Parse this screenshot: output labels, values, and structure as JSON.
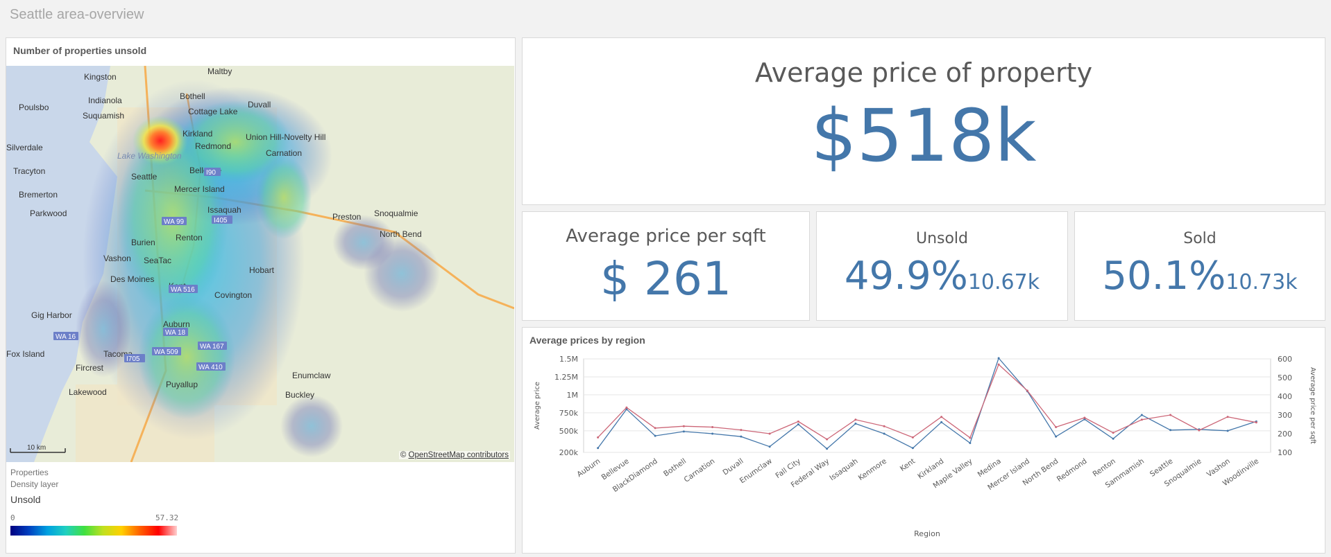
{
  "sheet": {
    "title": "Seattle area-overview"
  },
  "map_panel": {
    "title": "Number of properties unsold",
    "attribution_symbol": "©",
    "attribution": "OpenStreetMap contributors",
    "scale_label": "10 km",
    "places": [
      "Kingston",
      "Maltby",
      "Poulsbo",
      "Indianola",
      "Suquamish",
      "Bothell",
      "Cottage Lake",
      "Duvall",
      "Silverdale",
      "Kirkland",
      "Redmond",
      "Union Hill-Novelty Hill",
      "Carnation",
      "Lake Washington",
      "Tracyton",
      "Seattle",
      "Bellevue",
      "Bremerton",
      "Mercer Island",
      "Parkwood",
      "Issaquah",
      "Snoqualmie",
      "Preston",
      "North Bend",
      "Burien",
      "Renton",
      "Vashon",
      "SeaTac",
      "Hobart",
      "Des Moines",
      "Kent",
      "Covington",
      "Gig Harbor",
      "Auburn",
      "Tacoma",
      "Fox Island",
      "Fircrest",
      "Puyallup",
      "Lakewood",
      "Enumclaw",
      "Buckley"
    ],
    "road_labels": [
      "I90",
      "WA 99",
      "I405",
      "WA 516",
      "WA 16",
      "WA 18",
      "WA 509",
      "WA 167",
      "I705",
      "WA 410"
    ],
    "legend": {
      "layer_name": "Properties",
      "layer_type": "Density layer",
      "measure": "Unsold",
      "min": "0",
      "max": "57.32"
    }
  },
  "kpi_main": {
    "title": "Average price of property",
    "value": "$518k"
  },
  "kpi_sqft": {
    "title": "Average price per sqft",
    "value": "$ 261"
  },
  "kpi_unsold": {
    "title": "Unsold",
    "value": "49.9%",
    "sub": "10.67k"
  },
  "kpi_sold": {
    "title": "Sold",
    "value": "50.1%",
    "sub": "10.73k"
  },
  "chart_data": {
    "type": "line",
    "title": "Average prices by region",
    "xlabel": "Region",
    "ylabel": "Average price",
    "y2label": "Average price per sqft",
    "categories": [
      "Auburn",
      "Bellevue",
      "BlackDiamond",
      "Bothell",
      "Carnation",
      "Duvall",
      "Enumclaw",
      "Fall City",
      "Federal Way",
      "Issaquah",
      "Kenmore",
      "Kent",
      "Kirkland",
      "Maple Valley",
      "Medina",
      "Mercer Island",
      "North Bend",
      "Redmond",
      "Renton",
      "Sammamish",
      "Seattle",
      "Snoqualmie",
      "Vashon",
      "Woodinville"
    ],
    "ylim": [
      200000,
      1500000
    ],
    "y_ticks": [
      "200k",
      "500k",
      "750k",
      "1M",
      "1.25M",
      "1.5M"
    ],
    "y_tick_values": [
      200000,
      500000,
      750000,
      1000000,
      1250000,
      1500000
    ],
    "y2lim": [
      100,
      600
    ],
    "y2_ticks": [
      "100",
      "200",
      "300",
      "400",
      "500",
      "600"
    ],
    "y2_tick_values": [
      100,
      200,
      300,
      400,
      500,
      600
    ],
    "series": [
      {
        "axis": "left",
        "color": "#4477aa",
        "values": [
          260000,
          800000,
          430000,
          490000,
          460000,
          420000,
          280000,
          590000,
          250000,
          600000,
          460000,
          260000,
          620000,
          330000,
          1510000,
          1050000,
          420000,
          660000,
          390000,
          720000,
          510000,
          520000,
          500000,
          630000
        ]
      },
      {
        "axis": "right",
        "color": "#cc6677",
        "values": [
          180,
          340,
          230,
          240,
          235,
          220,
          200,
          265,
          170,
          275,
          240,
          180,
          290,
          178,
          570,
          430,
          235,
          285,
          205,
          275,
          300,
          218,
          290,
          260
        ]
      }
    ]
  }
}
